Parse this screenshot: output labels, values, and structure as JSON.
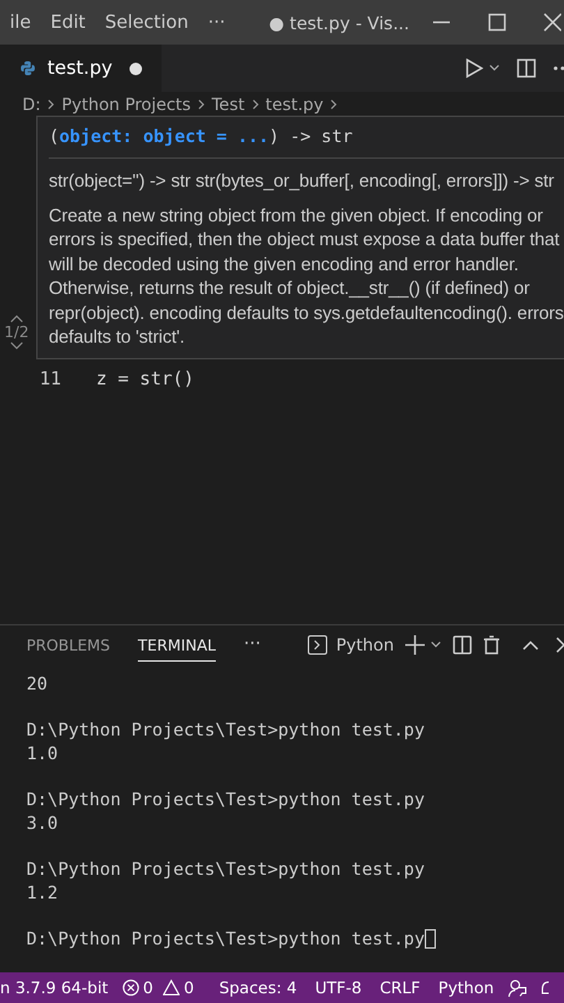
{
  "title_bar": {
    "menu": [
      "ile",
      "Edit",
      "Selection",
      "···"
    ],
    "title": "● test.py - Vis..."
  },
  "tabs": [
    {
      "label": "test.py",
      "modified": true,
      "selected": true
    }
  ],
  "breadcrumb": [
    "D:",
    "Python Projects",
    "Test",
    "test.py"
  ],
  "hover": {
    "signature": "(**object: object = ...**) -> str",
    "paging": "1/2",
    "doc": [
      "str(object='') -> str str(bytes_or_buffer[, encoding[, errors]]) -> str",
      "Create a new string object from the given object. If encoding or errors is specified, then the object must expose a data buffer that will be decoded using the given encoding and error handler. Otherwise, returns the result of object.__str__() (if defined) or repr(object). encoding defaults to sys.getdefaultencoding(). errors defaults to 'strict'."
    ]
  },
  "code_lines": [
    {
      "number": "11",
      "code": "z = str()"
    }
  ],
  "panel": {
    "tabs": [
      {
        "label": "PROBLEMS",
        "selected": false
      },
      {
        "label": "TERMINAL",
        "selected": true
      }
    ],
    "more": "···",
    "terminal_name": "Python",
    "output": [
      [
        "20"
      ],
      [
        "D:\\Python Projects\\Test>python test.py",
        "1.0"
      ],
      [
        "D:\\Python Projects\\Test>python test.py",
        "3.0"
      ],
      [
        "D:\\Python Projects\\Test>python test.py",
        "1.2"
      ],
      [
        "D:\\Python Projects\\Test>python test.py"
      ]
    ]
  },
  "status_bar": {
    "interpreter": "n 3.7.9 64-bit",
    "errors": "0",
    "warnings": "0",
    "items": [
      "Spaces: 4",
      "UTF-8",
      "CRLF",
      "Python"
    ]
  }
}
